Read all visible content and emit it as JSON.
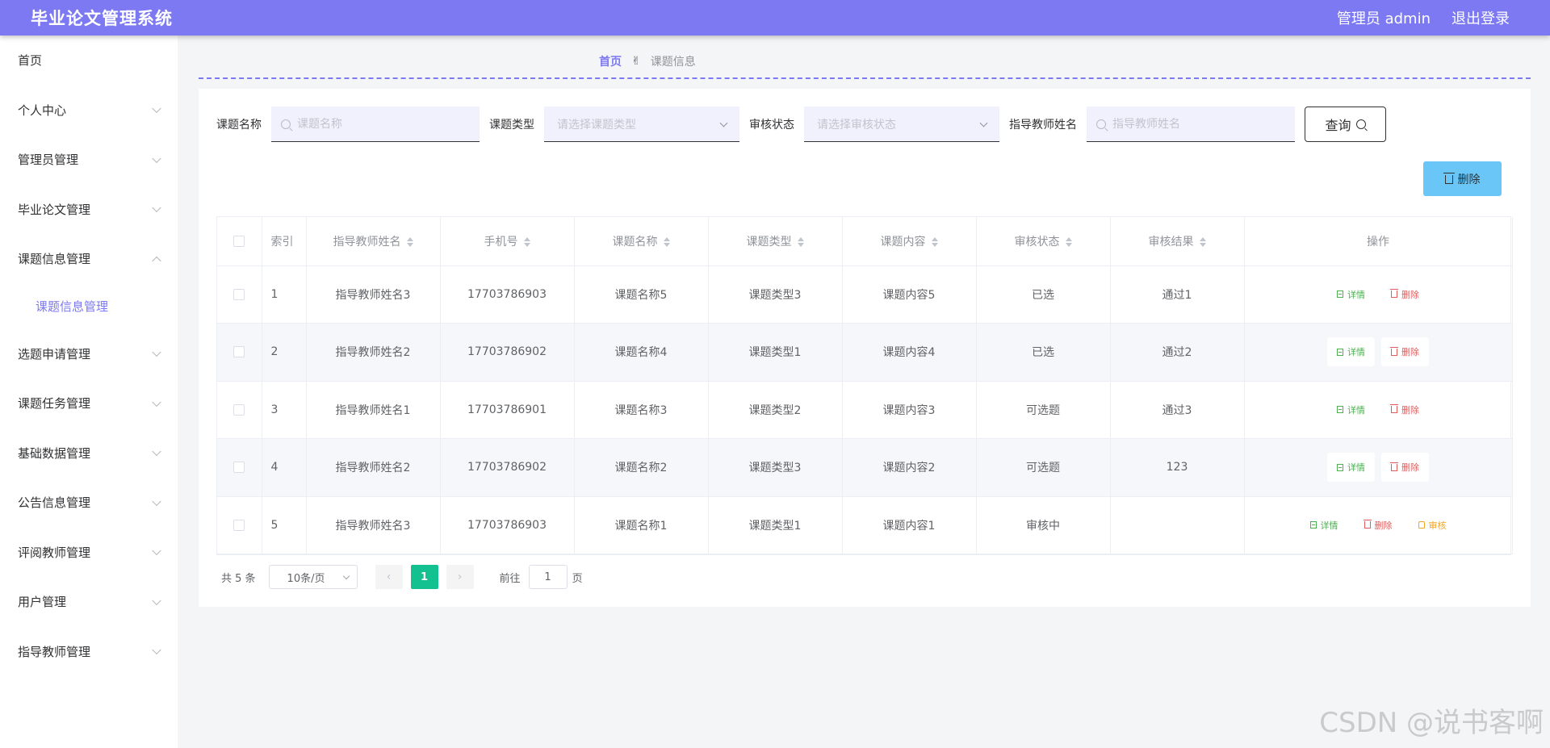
{
  "header": {
    "title": "毕业论文管理系统",
    "admin_label": "管理员 admin",
    "logout_label": "退出登录"
  },
  "sidebar": {
    "items": [
      {
        "label": "首页",
        "chevron": "none"
      },
      {
        "label": "个人中心",
        "chevron": "down"
      },
      {
        "label": "管理员管理",
        "chevron": "down"
      },
      {
        "label": "毕业论文管理",
        "chevron": "down"
      },
      {
        "label": "课题信息管理",
        "chevron": "up"
      },
      {
        "label": "课题信息管理",
        "chevron": "none",
        "sub": true
      },
      {
        "label": "选题申请管理",
        "chevron": "down"
      },
      {
        "label": "课题任务管理",
        "chevron": "down"
      },
      {
        "label": "基础数据管理",
        "chevron": "down"
      },
      {
        "label": "公告信息管理",
        "chevron": "down"
      },
      {
        "label": "评阅教师管理",
        "chevron": "down"
      },
      {
        "label": "用户管理",
        "chevron": "down"
      },
      {
        "label": "指导教师管理",
        "chevron": "down"
      }
    ]
  },
  "breadcrumb": {
    "home": "首页",
    "separator": "✌",
    "current": "课题信息"
  },
  "search": {
    "topic_label": "课题名称",
    "topic_placeholder": "课题名称",
    "type_label": "课题类型",
    "type_placeholder": "请选择课题类型",
    "status_label": "审核状态",
    "status_placeholder": "请选择审核状态",
    "teacher_label": "指导教师姓名",
    "teacher_placeholder": "指导教师姓名",
    "query_label": "查询"
  },
  "actions": {
    "delete_label": "删除"
  },
  "table": {
    "columns": [
      "索引",
      "指导教师姓名",
      "手机号",
      "课题名称",
      "课题类型",
      "课题内容",
      "审核状态",
      "审核结果",
      "操作"
    ],
    "rows": [
      {
        "index": "1",
        "teacher": "指导教师姓名3",
        "phone": "17703786903",
        "name": "课题名称5",
        "type": "课题类型3",
        "content": "课题内容5",
        "status": "已选",
        "result": "通过1",
        "ops": [
          "详情",
          "删除"
        ]
      },
      {
        "index": "2",
        "teacher": "指导教师姓名2",
        "phone": "17703786902",
        "name": "课题名称4",
        "type": "课题类型1",
        "content": "课题内容4",
        "status": "已选",
        "result": "通过2",
        "ops": [
          "详情",
          "删除"
        ]
      },
      {
        "index": "3",
        "teacher": "指导教师姓名1",
        "phone": "17703786901",
        "name": "课题名称3",
        "type": "课题类型2",
        "content": "课题内容3",
        "status": "可选题",
        "result": "通过3",
        "ops": [
          "详情",
          "删除"
        ]
      },
      {
        "index": "4",
        "teacher": "指导教师姓名2",
        "phone": "17703786902",
        "name": "课题名称2",
        "type": "课题类型3",
        "content": "课题内容2",
        "status": "可选题",
        "result": "123",
        "ops": [
          "详情",
          "删除"
        ]
      },
      {
        "index": "5",
        "teacher": "指导教师姓名3",
        "phone": "17703786903",
        "name": "课题名称1",
        "type": "课题类型1",
        "content": "课题内容1",
        "status": "审核中",
        "result": "",
        "ops": [
          "详情",
          "删除",
          "审核"
        ]
      }
    ]
  },
  "pagination": {
    "total": "共 5 条",
    "page_size": "10条/页",
    "current_page": "1",
    "goto_label": "前往",
    "goto_value": "1",
    "page_suffix": "页"
  },
  "watermark": "CSDN @说书客啊",
  "colors": {
    "header": "#7c79f2",
    "accent": "#7c79f2",
    "delete_button": "#69c6f7",
    "page_active": "#13c08f",
    "detail": "#4caf50",
    "delete": "#e05c5c",
    "audit": "#f5a623"
  }
}
